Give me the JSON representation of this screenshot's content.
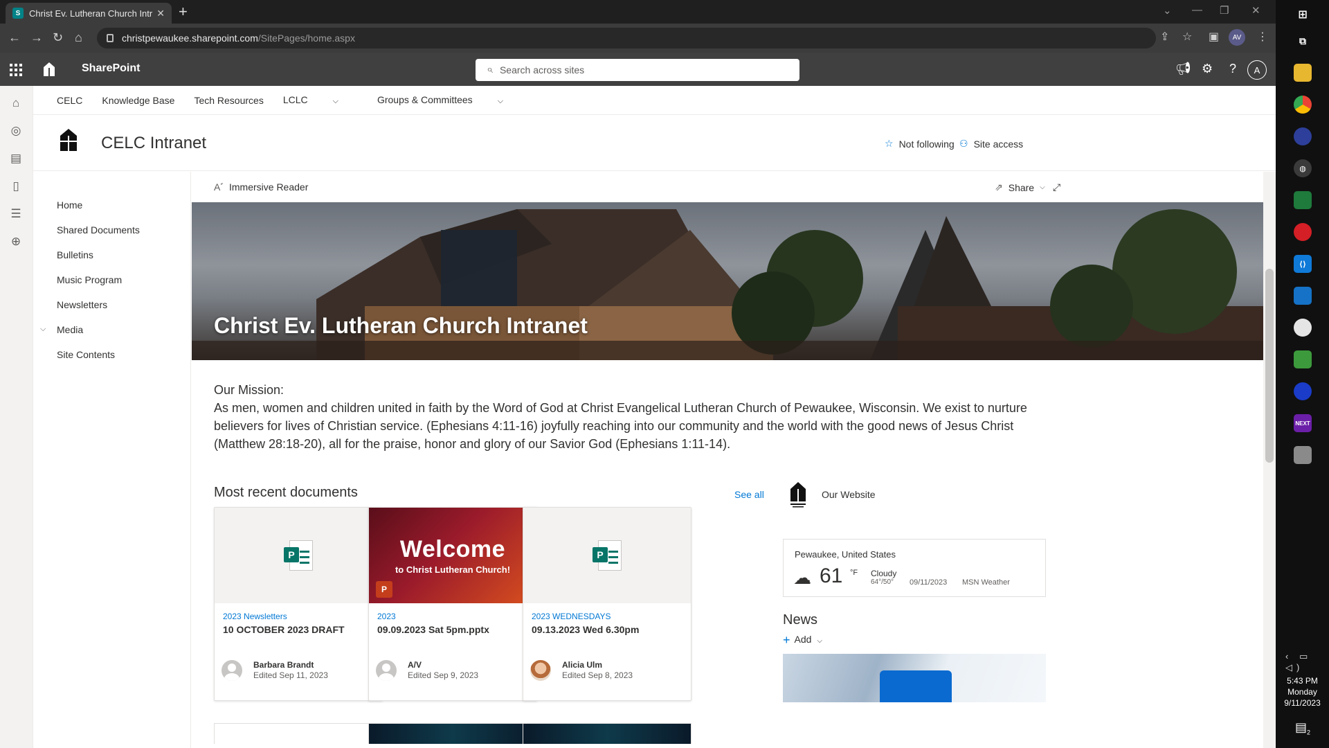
{
  "browser": {
    "tab_title": "Christ Ev. Lutheran Church Intran",
    "tab_close": "✕",
    "new_tab": "+",
    "url_host": "christpewaukee.sharepoint.com",
    "url_path": "/SitePages/home.aspx",
    "profile_initials": "AV"
  },
  "suitebar": {
    "app_name": "SharePoint",
    "search_placeholder": "Search across sites",
    "avatar_initial": "A"
  },
  "hubnav": {
    "items": [
      {
        "label": "CELC"
      },
      {
        "label": "Knowledge Base"
      },
      {
        "label": "Tech Resources"
      },
      {
        "label": "LCLC",
        "has_dropdown": true
      },
      {
        "label": "Groups & Committees",
        "has_dropdown": true
      }
    ]
  },
  "site": {
    "title": "CELC Intranet",
    "follow_label": "Not following",
    "access_label": "Site access"
  },
  "leftnav": {
    "items": [
      {
        "label": "Home"
      },
      {
        "label": "Shared Documents"
      },
      {
        "label": "Bulletins"
      },
      {
        "label": "Music Program"
      },
      {
        "label": "Newsletters"
      },
      {
        "label": "Media",
        "expandable": true
      },
      {
        "label": "Site Contents"
      }
    ]
  },
  "commandbar": {
    "immersive_reader": "Immersive Reader",
    "share": "Share"
  },
  "hero": {
    "title": "Christ Ev. Lutheran Church Intranet"
  },
  "mission": {
    "heading": "Our Mission:",
    "body": "As men, women and children united in faith by the Word of God at Christ Evangelical Lutheran Church of Pewaukee, Wisconsin. We exist to nurture believers for lives of Christian service. (Ephesians 4:11-16) joyfully reaching into our community and the world with the good news of Jesus Christ (Matthew 28:18-20), all for the praise, honor and glory of our Savior God (Ephesians 1:11-14)."
  },
  "documents": {
    "title": "Most recent documents",
    "see_all": "See all",
    "cards": [
      {
        "folder": "2023 Newsletters",
        "name": "10 OCTOBER 2023 DRAFT",
        "author": "Barbara Brandt",
        "edited": "Edited Sep 11, 2023",
        "thumb": "publisher-icon"
      },
      {
        "folder": "2023",
        "name": "09.09.2023 Sat 5pm.pptx",
        "author": "A/V",
        "edited": "Edited Sep 9, 2023",
        "thumb": "welcome-slide",
        "slide_big": "Welcome",
        "slide_small": "to Christ Lutheran Church!"
      },
      {
        "folder": "2023 WEDNESDAYS",
        "name": "09.13.2023 Wed 6.30pm",
        "author": "Alicia Ulm",
        "edited": "Edited Sep 8, 2023",
        "thumb": "publisher-icon"
      }
    ]
  },
  "quicklink": {
    "label": "Our Website"
  },
  "weather": {
    "location": "Pewaukee, United States",
    "temperature": "61",
    "unit": "°F",
    "condition": "Cloudy",
    "range": "64°/50°",
    "date": "09/11/2023",
    "provider": "MSN Weather"
  },
  "news": {
    "title": "News",
    "add_label": "Add"
  },
  "taskbar": {
    "time": "5:43 PM",
    "day": "Monday",
    "date": "9/11/2023",
    "notification_count": "2"
  },
  "colors": {
    "accent": "#0078d4",
    "suitebar": "#404040",
    "publisher": "#077568"
  }
}
